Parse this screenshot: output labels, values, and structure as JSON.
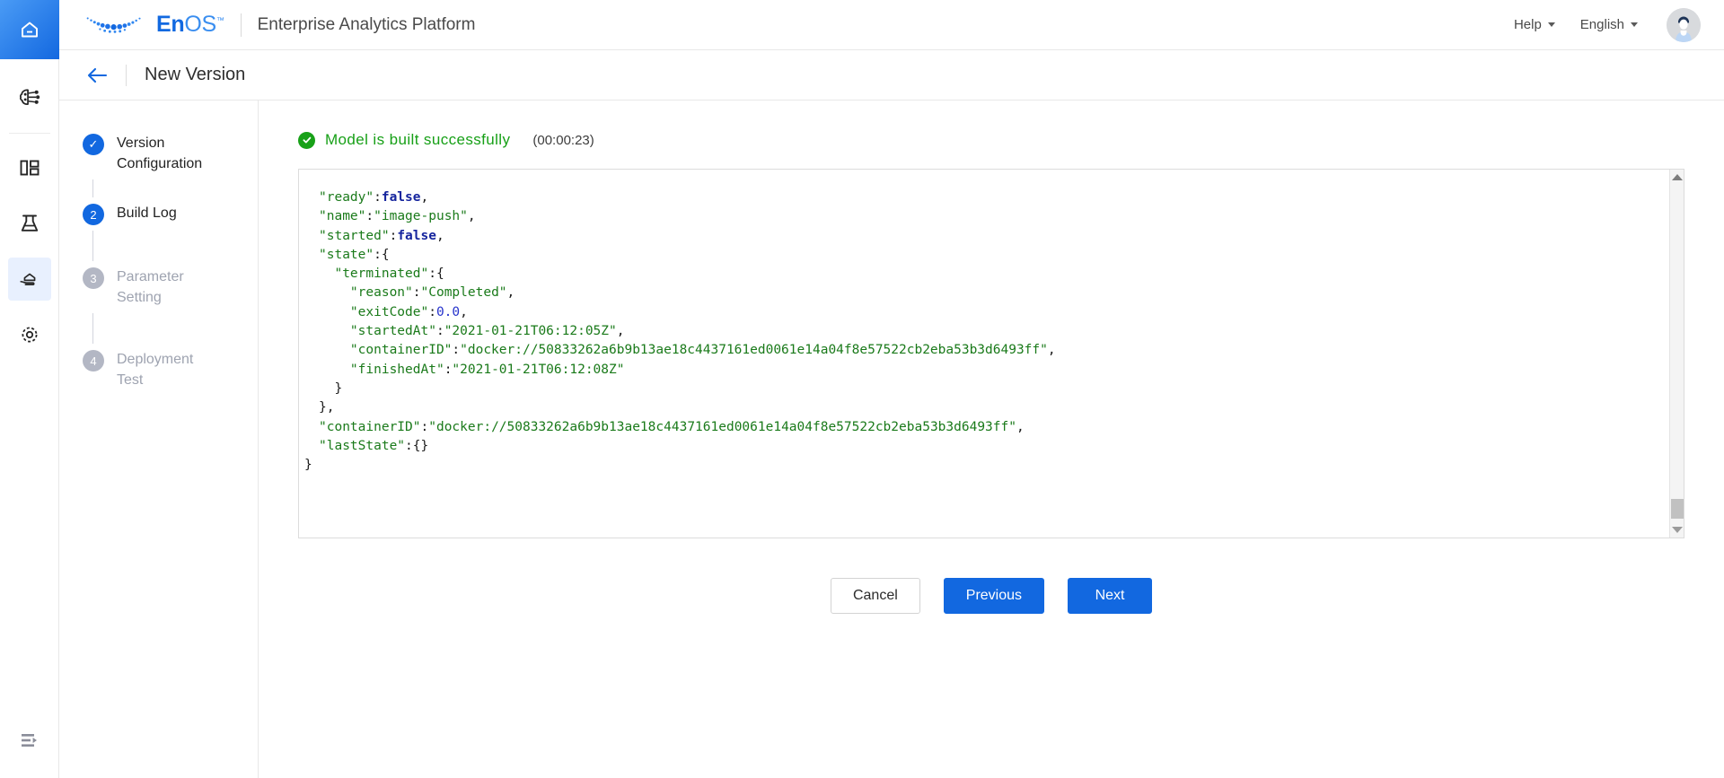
{
  "brand": {
    "logo_text_primary": "En",
    "logo_text_secondary": "OS",
    "logo_tm": "™",
    "app_title": "Enterprise Analytics Platform",
    "accent_color": "#1268e0",
    "success_color": "#17a017"
  },
  "topbar": {
    "help_label": "Help",
    "language_label": "English"
  },
  "page": {
    "title": "New Version"
  },
  "steps": [
    {
      "index": "1",
      "marker": "✓",
      "label": "Version Configuration",
      "state": "done"
    },
    {
      "index": "2",
      "marker": "2",
      "label": "Build Log",
      "state": "current"
    },
    {
      "index": "3",
      "marker": "3",
      "label": "Parameter Setting",
      "state": "pending"
    },
    {
      "index": "4",
      "marker": "4",
      "label": "Deployment Test",
      "state": "pending"
    }
  ],
  "build_status": {
    "icon": "check-circle-icon",
    "message": "Model is built successfully",
    "elapsed": "(00:00:23)"
  },
  "build_log": {
    "lines": [
      {
        "indent": 0,
        "tokens": [
          {
            "t": "punc",
            "v": "      ,"
          }
        ],
        "clipped": true
      },
      {
        "indent": 0,
        "tokens": [
          {
            "t": "key",
            "v": "\"ready\""
          },
          {
            "t": "punc",
            "v": ":"
          },
          {
            "t": "bool",
            "v": "false"
          },
          {
            "t": "punc",
            "v": ","
          }
        ]
      },
      {
        "indent": 0,
        "tokens": [
          {
            "t": "key",
            "v": "\"name\""
          },
          {
            "t": "punc",
            "v": ":"
          },
          {
            "t": "str",
            "v": "\"image-push\""
          },
          {
            "t": "punc",
            "v": ","
          }
        ]
      },
      {
        "indent": 0,
        "tokens": [
          {
            "t": "key",
            "v": "\"started\""
          },
          {
            "t": "punc",
            "v": ":"
          },
          {
            "t": "bool",
            "v": "false"
          },
          {
            "t": "punc",
            "v": ","
          }
        ]
      },
      {
        "indent": 0,
        "tokens": [
          {
            "t": "key",
            "v": "\"state\""
          },
          {
            "t": "punc",
            "v": ":{"
          }
        ]
      },
      {
        "indent": 1,
        "tokens": [
          {
            "t": "key",
            "v": "\"terminated\""
          },
          {
            "t": "punc",
            "v": ":{"
          }
        ]
      },
      {
        "indent": 2,
        "tokens": [
          {
            "t": "key",
            "v": "\"reason\""
          },
          {
            "t": "punc",
            "v": ":"
          },
          {
            "t": "str",
            "v": "\"Completed\""
          },
          {
            "t": "punc",
            "v": ","
          }
        ]
      },
      {
        "indent": 2,
        "tokens": [
          {
            "t": "key",
            "v": "\"exitCode\""
          },
          {
            "t": "punc",
            "v": ":"
          },
          {
            "t": "num",
            "v": "0.0"
          },
          {
            "t": "punc",
            "v": ","
          }
        ]
      },
      {
        "indent": 2,
        "tokens": [
          {
            "t": "key",
            "v": "\"startedAt\""
          },
          {
            "t": "punc",
            "v": ":"
          },
          {
            "t": "str",
            "v": "\"2021-01-21T06:12:05Z\""
          },
          {
            "t": "punc",
            "v": ","
          }
        ]
      },
      {
        "indent": 2,
        "tokens": [
          {
            "t": "key",
            "v": "\"containerID\""
          },
          {
            "t": "punc",
            "v": ":"
          },
          {
            "t": "str",
            "v": "\"docker://50833262a6b9b13ae18c4437161ed0061e14a04f8e57522cb2eba53b3d6493ff\""
          },
          {
            "t": "punc",
            "v": ","
          }
        ]
      },
      {
        "indent": 2,
        "tokens": [
          {
            "t": "key",
            "v": "\"finishedAt\""
          },
          {
            "t": "punc",
            "v": ":"
          },
          {
            "t": "str",
            "v": "\"2021-01-21T06:12:08Z\""
          }
        ]
      },
      {
        "indent": 1,
        "tokens": [
          {
            "t": "punc",
            "v": "}"
          }
        ]
      },
      {
        "indent": 0,
        "tokens": [
          {
            "t": "punc",
            "v": "},"
          }
        ]
      },
      {
        "indent": 0,
        "tokens": [
          {
            "t": "key",
            "v": "\"containerID\""
          },
          {
            "t": "punc",
            "v": ":"
          },
          {
            "t": "str",
            "v": "\"docker://50833262a6b9b13ae18c4437161ed0061e14a04f8e57522cb2eba53b3d6493ff\""
          },
          {
            "t": "punc",
            "v": ","
          }
        ]
      },
      {
        "indent": 0,
        "tokens": [
          {
            "t": "key",
            "v": "\"lastState\""
          },
          {
            "t": "punc",
            "v": ":{}"
          }
        ]
      },
      {
        "indent": -1,
        "tokens": [
          {
            "t": "punc",
            "v": "}"
          }
        ]
      },
      {
        "indent": -2,
        "tokens": [
          {
            "t": "punc",
            "v": "]"
          }
        ]
      }
    ]
  },
  "footer": {
    "cancel_label": "Cancel",
    "previous_label": "Previous",
    "next_label": "Next"
  },
  "sidebar_icons": [
    {
      "name": "ai-model-icon"
    },
    {
      "name": "dashboard-icon"
    },
    {
      "name": "lab-flask-icon"
    },
    {
      "name": "model-serving-icon",
      "active": true
    },
    {
      "name": "settings-gear-icon"
    }
  ]
}
